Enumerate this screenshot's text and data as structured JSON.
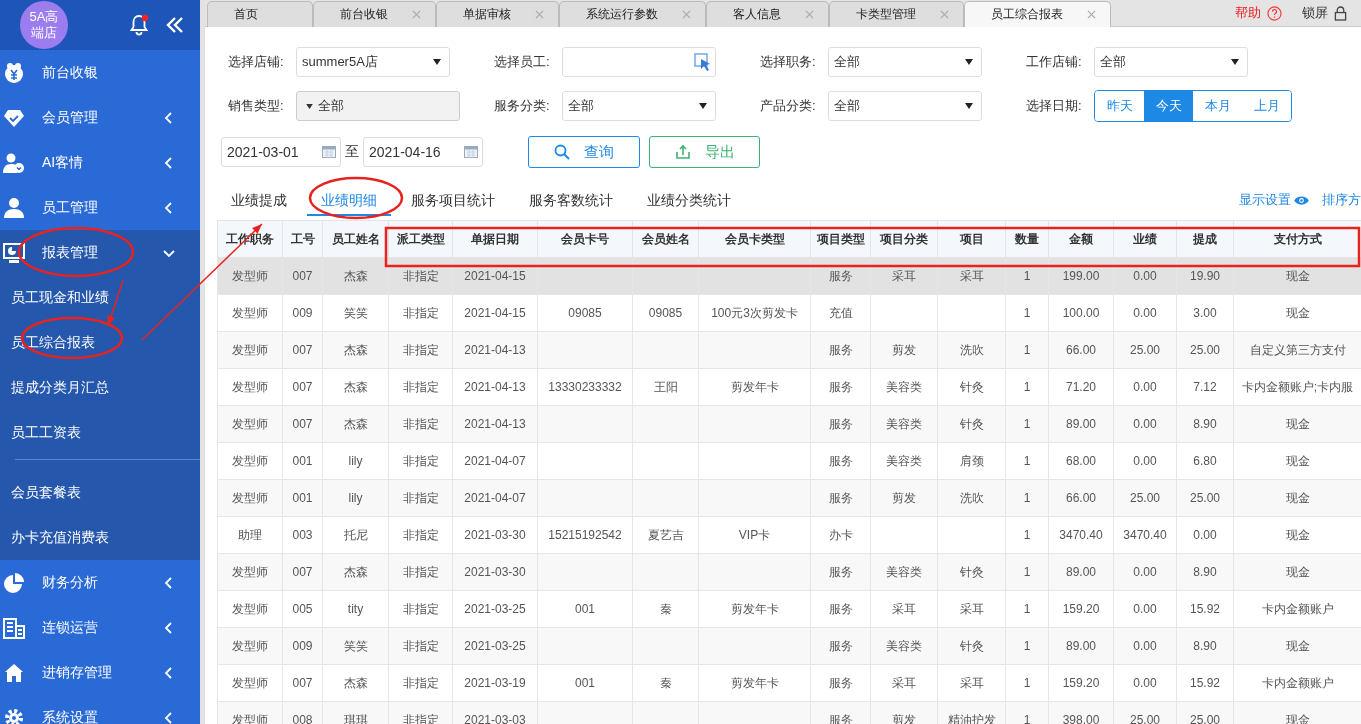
{
  "sidebar": {
    "logo_lines": [
      "5A高",
      "端店"
    ],
    "has_notification": true,
    "menu": [
      {
        "label": "前台收银",
        "kind": "money"
      },
      {
        "label": "会员管理",
        "kind": "diamond",
        "expanded": false
      },
      {
        "label": "AI客情",
        "kind": "person-heart",
        "expanded": false
      },
      {
        "label": "员工管理",
        "kind": "person",
        "expanded": false
      },
      {
        "label": "报表管理",
        "kind": "monitor",
        "expanded": true,
        "children": [
          {
            "label": "员工现金和业绩",
            "divider_after": false
          },
          {
            "label": "员工综合报表",
            "divider_after": false
          },
          {
            "label": "提成分类月汇总",
            "divider_after": false
          },
          {
            "label": "员工工资表",
            "divider_after": true
          },
          {
            "label": "会员套餐表",
            "divider_after": false
          },
          {
            "label": "办卡充值消费表",
            "divider_after": false
          }
        ]
      },
      {
        "label": "财务分析",
        "kind": "pie",
        "expanded": false
      },
      {
        "label": "连锁运营",
        "kind": "building",
        "expanded": false
      },
      {
        "label": "进销存管理",
        "kind": "house",
        "expanded": false
      },
      {
        "label": "系统设置",
        "kind": "gear",
        "expanded": false
      }
    ]
  },
  "tabs": [
    {
      "label": "首页",
      "closable": false,
      "selected": false
    },
    {
      "label": "前台收银",
      "closable": true,
      "selected": false
    },
    {
      "label": "单据审核",
      "closable": true,
      "selected": false
    },
    {
      "label": "系统运行参数",
      "closable": true,
      "selected": false
    },
    {
      "label": "客人信息",
      "closable": true,
      "selected": false
    },
    {
      "label": "卡类型管理",
      "closable": true,
      "selected": false
    },
    {
      "label": "员工综合报表",
      "closable": true,
      "selected": true
    }
  ],
  "top_links": {
    "help": "帮助",
    "lock": "锁屏"
  },
  "filters": [
    {
      "label": "选择店铺:",
      "kind": "select",
      "value": "summer5A店"
    },
    {
      "label": "选择员工:",
      "kind": "picker"
    },
    {
      "label": "选择职务:",
      "kind": "select",
      "value": "全部"
    },
    {
      "label": "工作店铺:",
      "kind": "select",
      "value": "全部"
    },
    {
      "label": "销售类型:",
      "kind": "multi",
      "value": "全部"
    },
    {
      "label": "服务分类:",
      "kind": "select",
      "value": "全部"
    },
    {
      "label": "产品分类:",
      "kind": "select",
      "value": "全部"
    },
    {
      "label": "选择日期:",
      "kind": "segments",
      "options": [
        {
          "label": "昨天",
          "selected": false
        },
        {
          "label": "今天",
          "selected": true
        },
        {
          "label": "本月",
          "selected": false
        },
        {
          "label": "上月",
          "selected": false
        }
      ]
    }
  ],
  "date_range": {
    "from": "2021-03-01",
    "separator": "至",
    "to": "2021-04-16"
  },
  "buttons": {
    "search": "查询",
    "export": "导出"
  },
  "report_tabs": [
    {
      "label": "业绩提成",
      "selected": false
    },
    {
      "label": "业绩明细",
      "selected": true
    },
    {
      "label": "服务项目统计",
      "selected": false
    },
    {
      "label": "服务客数统计",
      "selected": false
    },
    {
      "label": "业绩分类统计",
      "selected": false
    }
  ],
  "display_settings": "显示设置",
  "sort_link": "排序方",
  "table": {
    "columns": [
      "工作职务",
      "工号",
      "员工姓名",
      "派工类型",
      "单据日期",
      "会员卡号",
      "会员姓名",
      "会员卡类型",
      "项目类型",
      "项目分类",
      "项目",
      "数量",
      "金额",
      "业绩",
      "提成",
      "支付方式"
    ],
    "rows": [
      {
        "selected": true,
        "cells": [
          "发型师",
          "007",
          "杰森",
          "非指定",
          "2021-04-15",
          null,
          null,
          null,
          "服务",
          "采耳",
          "采耳",
          "1",
          "199.00",
          "0.00",
          "19.90",
          "现金"
        ]
      },
      {
        "selected": false,
        "cells": [
          "发型师",
          "009",
          "笑笑",
          "非指定",
          "2021-04-15",
          "09085",
          "09085",
          "100元3次剪发卡",
          "充值",
          null,
          null,
          "1",
          "100.00",
          "0.00",
          "3.00",
          "现金"
        ]
      },
      {
        "selected": false,
        "cells": [
          "发型师",
          "007",
          "杰森",
          "非指定",
          "2021-04-13",
          null,
          null,
          null,
          "服务",
          "剪发",
          "洗吹",
          "1",
          "66.00",
          "25.00",
          "25.00",
          "自定义第三方支付"
        ]
      },
      {
        "selected": false,
        "cells": [
          "发型师",
          "007",
          "杰森",
          "非指定",
          "2021-04-13",
          "13330233332",
          "王阳",
          "剪发年卡",
          "服务",
          "美容类",
          "针灸",
          "1",
          "71.20",
          "0.00",
          "7.12",
          "卡内金额账户;卡内服"
        ]
      },
      {
        "selected": false,
        "cells": [
          "发型师",
          "007",
          "杰森",
          "非指定",
          "2021-04-13",
          null,
          null,
          null,
          "服务",
          "美容类",
          "针灸",
          "1",
          "89.00",
          "0.00",
          "8.90",
          "现金"
        ]
      },
      {
        "selected": false,
        "cells": [
          "发型师",
          "001",
          "lily",
          "非指定",
          "2021-04-07",
          null,
          null,
          null,
          "服务",
          "美容类",
          "肩颈",
          "1",
          "68.00",
          "0.00",
          "6.80",
          "现金"
        ]
      },
      {
        "selected": false,
        "cells": [
          "发型师",
          "001",
          "lily",
          "非指定",
          "2021-04-07",
          null,
          null,
          null,
          "服务",
          "剪发",
          "洗吹",
          "1",
          "66.00",
          "25.00",
          "25.00",
          "现金"
        ]
      },
      {
        "selected": false,
        "cells": [
          "助理",
          "003",
          "托尼",
          "非指定",
          "2021-03-30",
          "15215192542",
          "夏艺吉",
          "VIP卡",
          "办卡",
          null,
          null,
          "1",
          "3470.40",
          "3470.40",
          "0.00",
          "现金"
        ]
      },
      {
        "selected": false,
        "cells": [
          "发型师",
          "007",
          "杰森",
          "非指定",
          "2021-03-30",
          null,
          null,
          null,
          "服务",
          "美容类",
          "针灸",
          "1",
          "89.00",
          "0.00",
          "8.90",
          "现金"
        ]
      },
      {
        "selected": false,
        "cells": [
          "发型师",
          "005",
          "tity",
          "非指定",
          "2021-03-25",
          "001",
          "秦",
          "剪发年卡",
          "服务",
          "采耳",
          "采耳",
          "1",
          "159.20",
          "0.00",
          "15.92",
          "卡内金额账户"
        ]
      },
      {
        "selected": false,
        "cells": [
          "发型师",
          "009",
          "笑笑",
          "非指定",
          "2021-03-25",
          null,
          null,
          null,
          "服务",
          "美容类",
          "针灸",
          "1",
          "89.00",
          "0.00",
          "8.90",
          "现金"
        ]
      },
      {
        "selected": false,
        "cells": [
          "发型师",
          "007",
          "杰森",
          "非指定",
          "2021-03-19",
          "001",
          "秦",
          "剪发年卡",
          "服务",
          "采耳",
          "采耳",
          "1",
          "159.20",
          "0.00",
          "15.92",
          "卡内金额账户"
        ]
      },
      {
        "selected": false,
        "cells": [
          "发型师",
          "008",
          "琪琪",
          "非指定",
          "2021-03-03",
          null,
          null,
          null,
          "服务",
          "剪发",
          "精油护发",
          "1",
          "398.00",
          "25.00",
          "25.00",
          "现金"
        ]
      }
    ]
  },
  "annotations": [
    {
      "kind": "ellipse"
    },
    {
      "kind": "ellipse"
    },
    {
      "kind": "ellipse"
    },
    {
      "kind": "rectangle"
    },
    {
      "kind": "arrow"
    },
    {
      "kind": "arrow"
    }
  ]
}
